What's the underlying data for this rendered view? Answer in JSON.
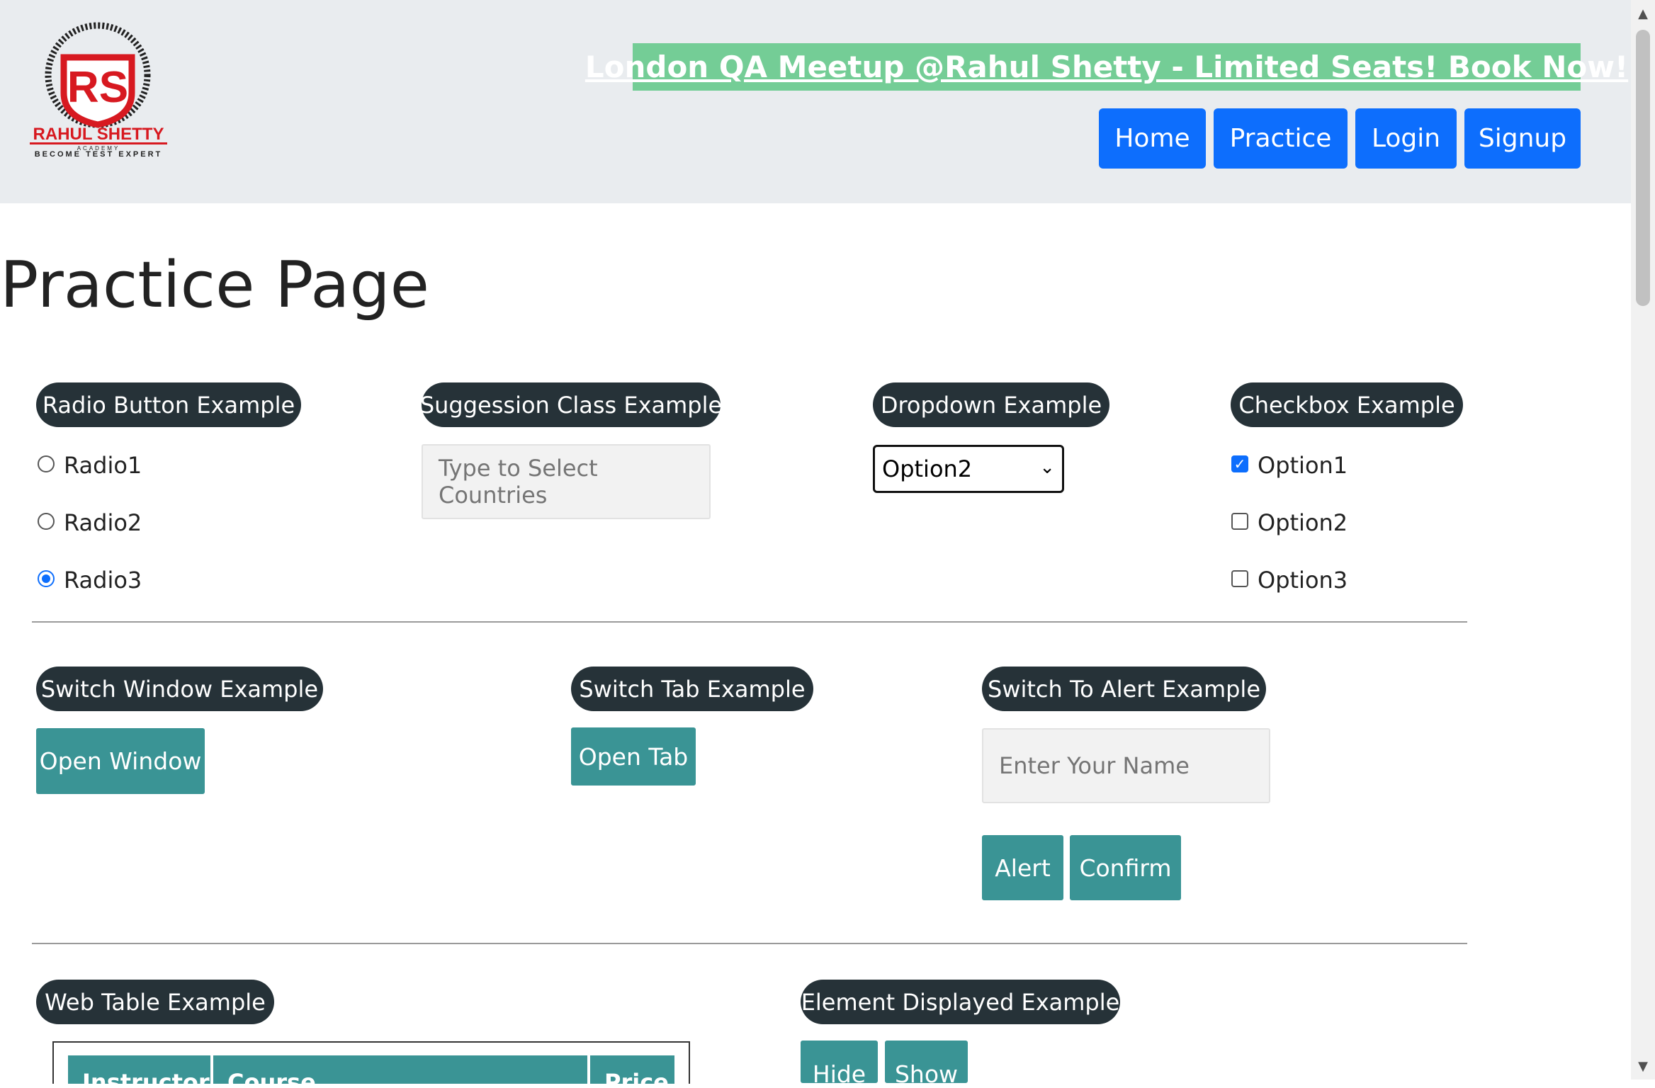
{
  "header": {
    "logo": {
      "title": "RAHUL SHETTY",
      "sub": "ACADEMY",
      "tagline": "BECOME TEST EXPERT",
      "monogram": "RS"
    },
    "banner": "London QA Meetup @Rahul Shetty - Limited Seats! Book Now!",
    "nav": [
      "Home",
      "Practice",
      "Login",
      "Signup"
    ]
  },
  "page_title": "Practice Page",
  "radio": {
    "legend": "Radio Button Example",
    "options": [
      "Radio1",
      "Radio2",
      "Radio3"
    ],
    "selected": "Radio3"
  },
  "suggestion": {
    "legend": "Suggession Class Example",
    "placeholder": "Type to Select Countries"
  },
  "dropdown": {
    "legend": "Dropdown Example",
    "selected": "Option2"
  },
  "checkbox": {
    "legend": "Checkbox Example",
    "options": [
      "Option1",
      "Option2",
      "Option3"
    ],
    "checked": [
      "Option1"
    ]
  },
  "switch_window": {
    "legend": "Switch Window Example",
    "button": "Open Window"
  },
  "switch_tab": {
    "legend": "Switch Tab Example",
    "button": "Open Tab"
  },
  "alert": {
    "legend": "Switch To Alert Example",
    "placeholder": "Enter Your Name",
    "alert_button": "Alert",
    "confirm_button": "Confirm"
  },
  "web_table": {
    "legend": "Web Table Example",
    "columns": [
      "Instructor",
      "Course",
      "Price"
    ]
  },
  "element_displayed": {
    "legend": "Element Displayed Example",
    "hide_button": "Hide",
    "show_button": "Show"
  },
  "colors": {
    "header_bg": "#e9ecef",
    "banner_bg": "#74cd96",
    "nav_blue": "#0d6efd",
    "pill_bg": "#263238",
    "teal": "#3a9495"
  }
}
